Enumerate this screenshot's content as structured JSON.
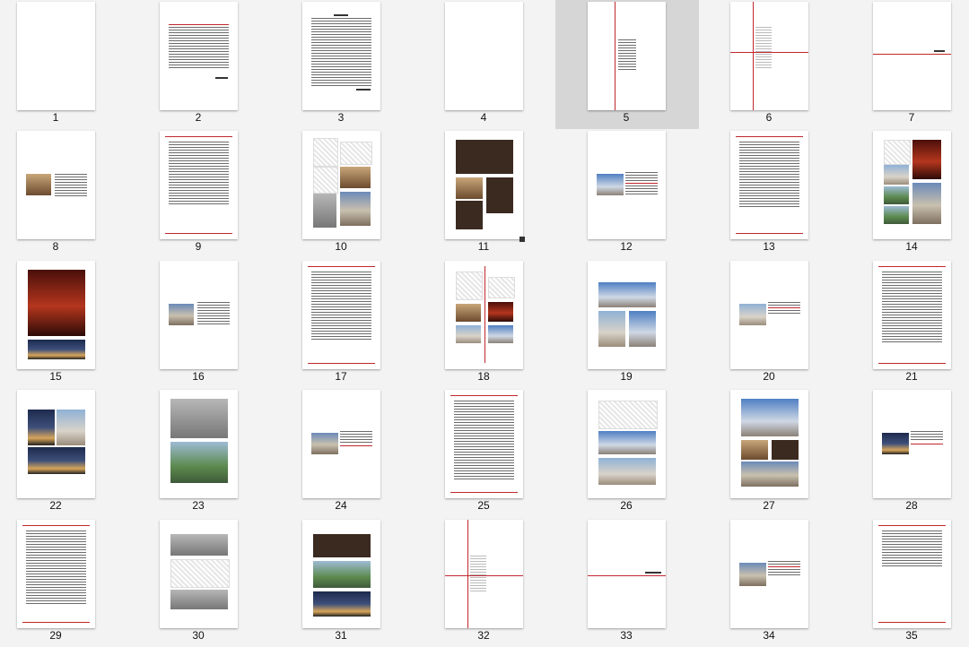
{
  "pages": [
    "1",
    "2",
    "3",
    "4",
    "5",
    "6",
    "7",
    "8",
    "9",
    "10",
    "11",
    "12",
    "13",
    "14",
    "15",
    "16",
    "17",
    "18",
    "19",
    "20",
    "21",
    "22",
    "23",
    "24",
    "25",
    "26",
    "27",
    "28",
    "29",
    "30",
    "31",
    "32",
    "33",
    "34",
    "35"
  ],
  "selected_page": "5"
}
